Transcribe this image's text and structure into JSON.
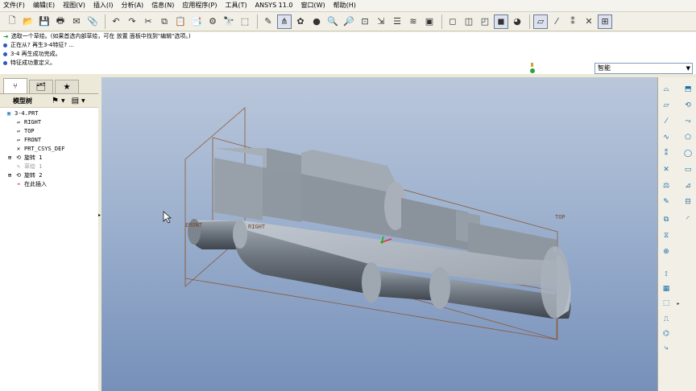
{
  "menu": [
    "文件(F)",
    "编辑(E)",
    "视图(V)",
    "插入(I)",
    "分析(A)",
    "信息(N)",
    "应用程序(P)",
    "工具(T)",
    "ANSYS 11.0",
    "窗口(W)",
    "帮助(H)"
  ],
  "messages": [
    "选取一个草绘。(如果首选内部草绘，可在 放置 面板中找到\"编辑\"选项。)",
    "正在从? 再生3-4特征? ...",
    "3-4 再生成功完成。",
    "特征成功重定义。"
  ],
  "selection_filter": "智能",
  "tree": {
    "header": "模型树",
    "items": [
      {
        "label": "3-4.PRT",
        "icon": "part-icon",
        "dim": false
      },
      {
        "label": "RIGHT",
        "icon": "datum-plane-icon",
        "dim": false
      },
      {
        "label": "TOP",
        "icon": "datum-plane-icon",
        "dim": false
      },
      {
        "label": "FRONT",
        "icon": "datum-plane-icon",
        "dim": false
      },
      {
        "label": "PRT_CSYS_DEF",
        "icon": "csys-icon",
        "dim": false
      },
      {
        "label": "旋转 1",
        "icon": "revolve-icon",
        "dim": false
      },
      {
        "label": "草绘 1",
        "icon": "sketch-icon",
        "dim": true
      },
      {
        "label": "旋转 2",
        "icon": "revolve-icon",
        "dim": false
      },
      {
        "label": "在此插入",
        "icon": "insert-here-icon",
        "dim": false
      }
    ]
  },
  "viewport": {
    "datum_labels": {
      "front": "FRONT",
      "right": "RIGHT",
      "top": "TOP"
    }
  },
  "colors": {
    "accent": "#2B59C3",
    "viewport_top": "#BAC7DB",
    "viewport_bottom": "#7690BA",
    "datum": "#8A5A3A",
    "part": "#A8B1BC"
  }
}
